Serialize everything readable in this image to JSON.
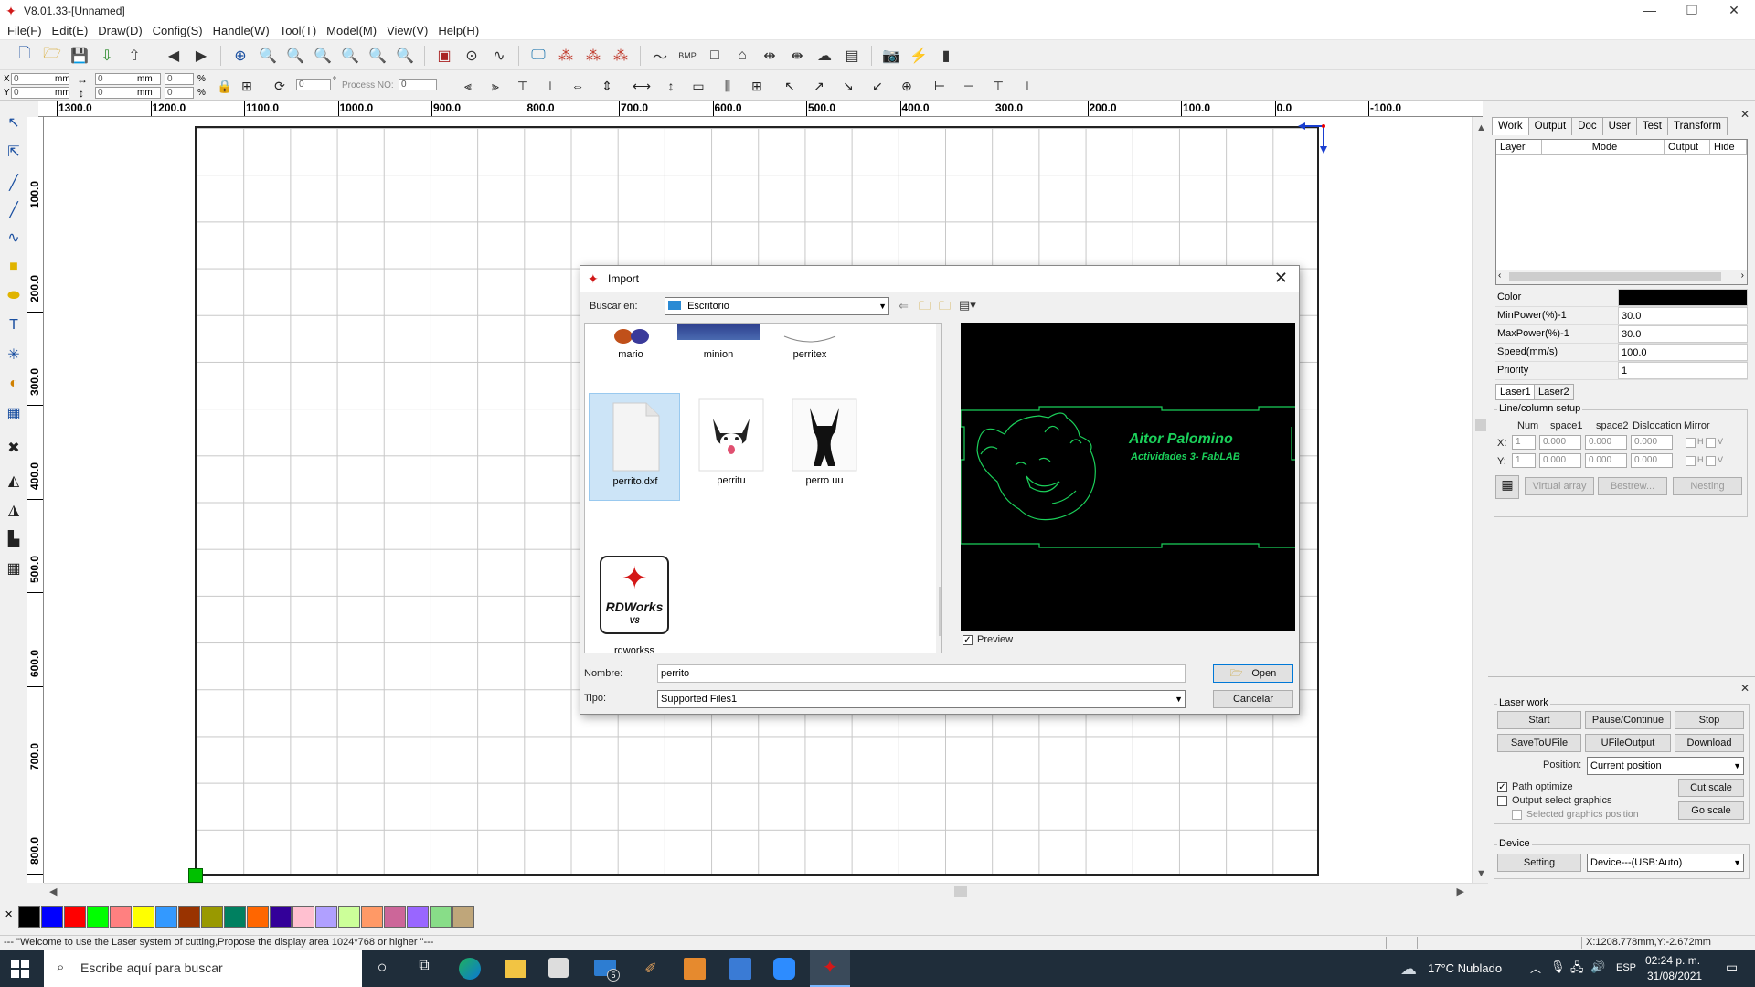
{
  "window": {
    "title": "V8.01.33-[Unnamed]",
    "minimize": "—",
    "restore": "❐",
    "close": "✕"
  },
  "menu": [
    "File(F)",
    "Edit(E)",
    "Draw(D)",
    "Config(S)",
    "Handle(W)",
    "Tool(T)",
    "Model(M)",
    "View(V)",
    "Help(H)"
  ],
  "toolbar2": {
    "x_label": "X",
    "y_label": "Y",
    "x_value": "0",
    "y_value": "0",
    "w_value": "0",
    "h_value": "0",
    "unit": "mm",
    "pct": "%",
    "pct_x": "0",
    "pct_y": "0",
    "rotate_value": "0",
    "degree": "°",
    "process_no_label": "Process NO:",
    "process_no_value": "0"
  },
  "ruler": {
    "h_labels": [
      "1300.0",
      "1200.0",
      "1100.0",
      "1000.0",
      "900.0",
      "800.0",
      "700.0",
      "600.0",
      "500.0",
      "400.0",
      "300.0",
      "200.0",
      "100.0",
      "0.0",
      "-100.0"
    ],
    "v_labels": [
      "100.0",
      "200.0",
      "300.0",
      "400.0",
      "500.0",
      "600.0",
      "700.0",
      "800.0"
    ]
  },
  "palette": [
    "#000000",
    "#0000ff",
    "#ff0000",
    "#00ff00",
    "#ff8080",
    "#ffff00",
    "#3399ff",
    "#993300",
    "#999900",
    "#008060",
    "#ff6600",
    "#330099",
    "#ffc0d0",
    "#b0a0ff",
    "#ccff99",
    "#ff9966",
    "#cc6699",
    "#9966ff",
    "#88dd88",
    "#bfa67a"
  ],
  "status": {
    "message": "--- \"Welcome to use the Laser system of cutting,Propose the display area 1024*768 or higher \"---",
    "coords": "X:1208.778mm,Y:-2.672mm"
  },
  "right_panel": {
    "tabs": [
      "Work",
      "Output",
      "Doc",
      "User",
      "Test",
      "Transform"
    ],
    "layer_headers": [
      "Layer",
      "Mode",
      "Output",
      "Hide"
    ],
    "props": [
      {
        "label": "Color",
        "value": ""
      },
      {
        "label": "MinPower(%)-1",
        "value": "30.0"
      },
      {
        "label": "MaxPower(%)-1",
        "value": "30.0"
      },
      {
        "label": "Speed(mm/s)",
        "value": "100.0"
      },
      {
        "label": "Priority",
        "value": "1"
      }
    ],
    "laser_tabs": [
      "Laser1",
      "Laser2"
    ],
    "line_setup": {
      "title": "Line/column setup",
      "headers": [
        "Num",
        "space1",
        "space2",
        "Dislocation",
        "Mirror"
      ],
      "x_label": "X:",
      "y_label": "Y:",
      "x_values": [
        "1",
        "0.000",
        "0.000",
        "0.000"
      ],
      "y_values": [
        "1",
        "0.000",
        "0.000",
        "0.000"
      ],
      "h": "H",
      "v": "V",
      "virtual_array": "Virtual array",
      "bestrew": "Bestrew...",
      "nesting": "Nesting"
    },
    "laser_work": {
      "title": "Laser work",
      "start": "Start",
      "pause": "Pause/Continue",
      "stop": "Stop",
      "save_to_ufile": "SaveToUFile",
      "ufile_output": "UFileOutput",
      "download": "Download",
      "position_label": "Position:",
      "position_value": "Current position",
      "path_optimize": "Path optimize",
      "output_select": "Output select graphics",
      "selected_position": "Selected graphics position",
      "cut_scale": "Cut scale",
      "go_scale": "Go scale"
    },
    "device": {
      "title": "Device",
      "setting": "Setting",
      "device_value": "Device---(USB:Auto)"
    }
  },
  "dialog": {
    "title": "Import",
    "look_in_label": "Buscar en:",
    "look_in_value": "Escritorio",
    "files": [
      {
        "name": "mario"
      },
      {
        "name": "minion"
      },
      {
        "name": "perritex"
      },
      {
        "name": "perrito.dxf"
      },
      {
        "name": "perritu"
      },
      {
        "name": "perro uu"
      },
      {
        "name": "rdworkss"
      }
    ],
    "rdworks_logo_text": "RDWorks",
    "rdworks_logo_sub": "V8",
    "preview_label": "Preview",
    "preview_text1": "Aitor Palomino",
    "preview_text2": "Actividades 3- FabLAB",
    "name_label": "Nombre:",
    "name_value": "perrito",
    "type_label": "Tipo:",
    "type_value": "Supported Files1",
    "open": "Open",
    "cancel": "Cancelar"
  },
  "taskbar": {
    "search_placeholder": "Escribe aquí para buscar",
    "weather": "17°C  Nublado",
    "lang": "ESP",
    "time": "02:24 p. m.",
    "date": "31/08/2021",
    "mail_badge": "5"
  }
}
